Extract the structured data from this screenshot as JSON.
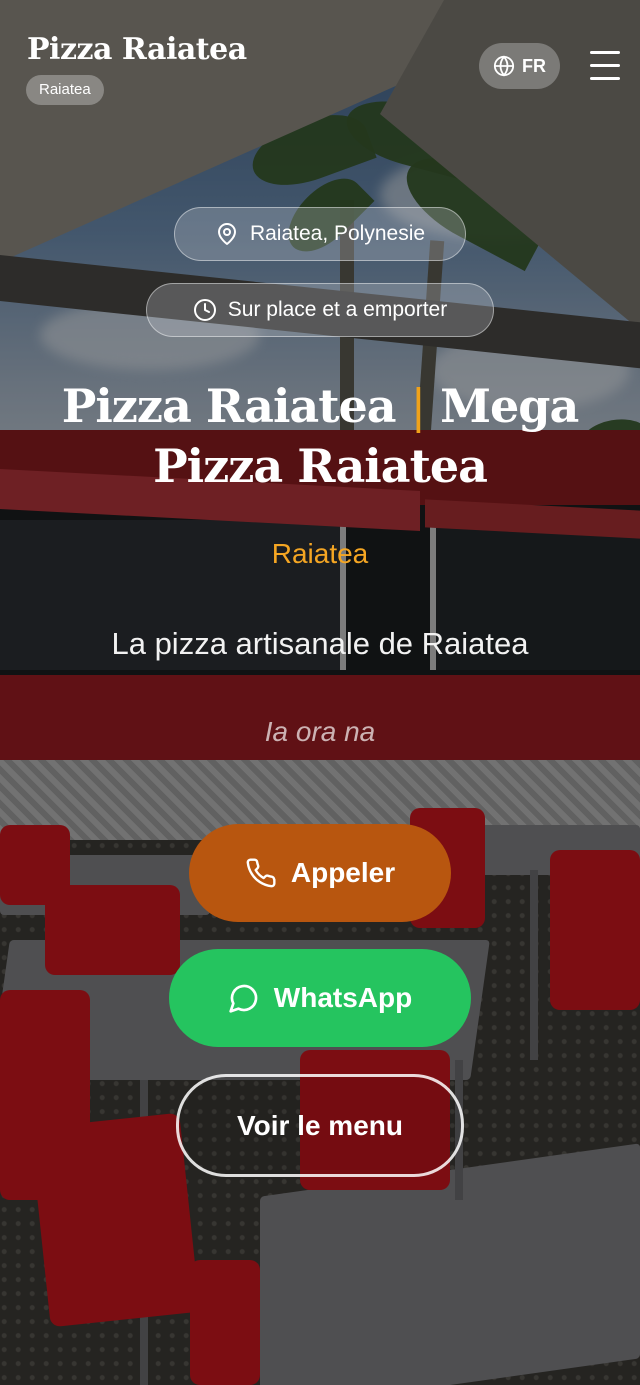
{
  "header": {
    "brand": "Pizza Raiatea",
    "badge": "Raiatea",
    "language": "FR",
    "icons": {
      "language": "globe-icon",
      "menu": "hamburger-menu-icon"
    }
  },
  "hero": {
    "location_pill": "Raiatea, Polynesie",
    "service_pill": "Sur place et a emporter",
    "title_part1": "Pizza Raiatea",
    "title_separator": "|",
    "title_part2": "Mega Pizza Raiatea",
    "location": "Raiatea",
    "tagline": "La pizza artisanale de Raiatea",
    "greeting": "Ia ora na"
  },
  "actions": {
    "call_label": "Appeler",
    "whatsapp_label": "WhatsApp",
    "menu_label": "Voir le menu"
  },
  "colors": {
    "accent": "#f5a623",
    "call_button": "#b8560f",
    "whatsapp_button": "#25c45f"
  }
}
